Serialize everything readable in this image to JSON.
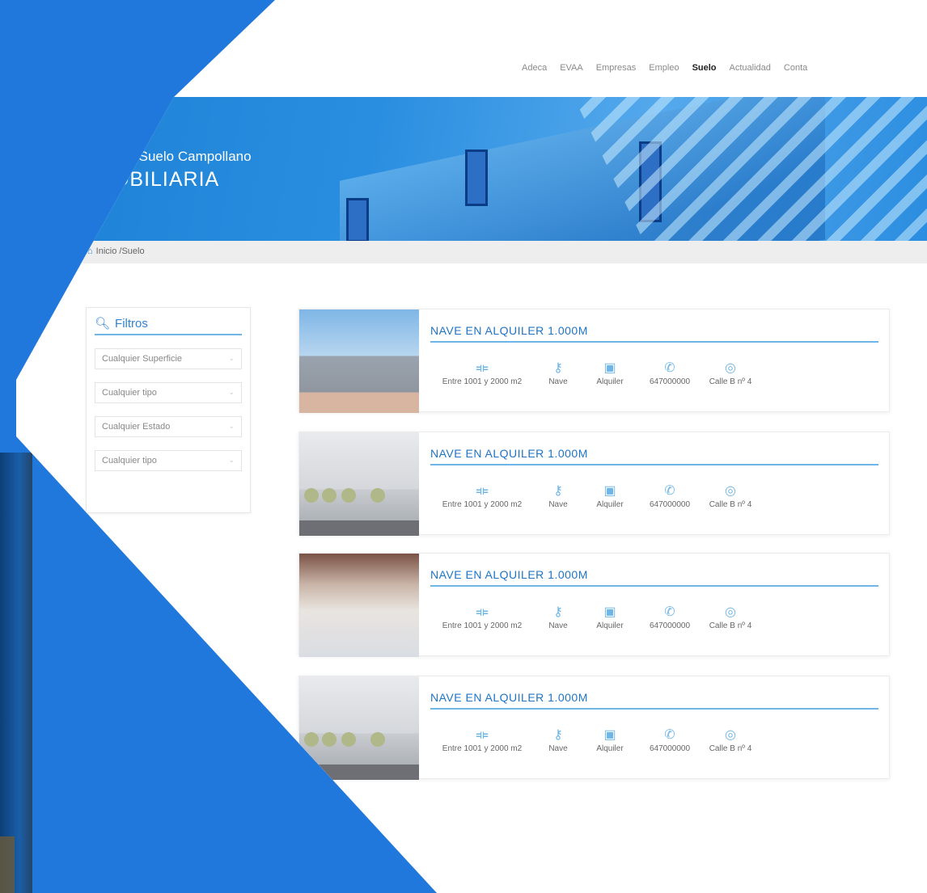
{
  "nav": {
    "items": [
      "Adeca",
      "EVAA",
      "Empresas",
      "Empleo",
      "Suelo",
      "Actualidad",
      "Conta"
    ],
    "active": "Suelo"
  },
  "hero": {
    "subtitle": "de Suelo Campollano",
    "title": "IOBILIARIA"
  },
  "breadcrumb": {
    "home": "Inicio",
    "separator": "/",
    "current": "Suelo"
  },
  "filters": {
    "title": "Filtros",
    "selects": [
      "Cualquier Superficie",
      "Cualquier tipo",
      "Cualquier Estado",
      "Cualquier tipo"
    ]
  },
  "listings": [
    {
      "title": "NAVE EN ALQUILER 1.000M",
      "size": "Entre 1001 y 2000 m2",
      "type": "Nave",
      "mode": "Alquiler",
      "phone": "647000000",
      "address": "Calle B nº 4"
    },
    {
      "title": "NAVE EN ALQUILER 1.000M",
      "size": "Entre 1001 y 2000 m2",
      "type": "Nave",
      "mode": "Alquiler",
      "phone": "647000000",
      "address": "Calle B nº 4"
    },
    {
      "title": "NAVE EN ALQUILER 1.000M",
      "size": "Entre 1001 y 2000 m2",
      "type": "Nave",
      "mode": "Alquiler",
      "phone": "647000000",
      "address": "Calle B nº 4"
    },
    {
      "title": "NAVE EN ALQUILER 1.000M",
      "size": "Entre 1001 y 2000 m2",
      "type": "Nave",
      "mode": "Alquiler",
      "phone": "647000000",
      "address": "Calle B nº 4"
    }
  ],
  "icons": [
    "expand-icon",
    "key-icon",
    "wallet-icon",
    "phone-icon",
    "location-pin-icon"
  ],
  "colors": {
    "brand": "#2178dc",
    "accent": "#6fb6e6",
    "title": "#1f74c4"
  }
}
